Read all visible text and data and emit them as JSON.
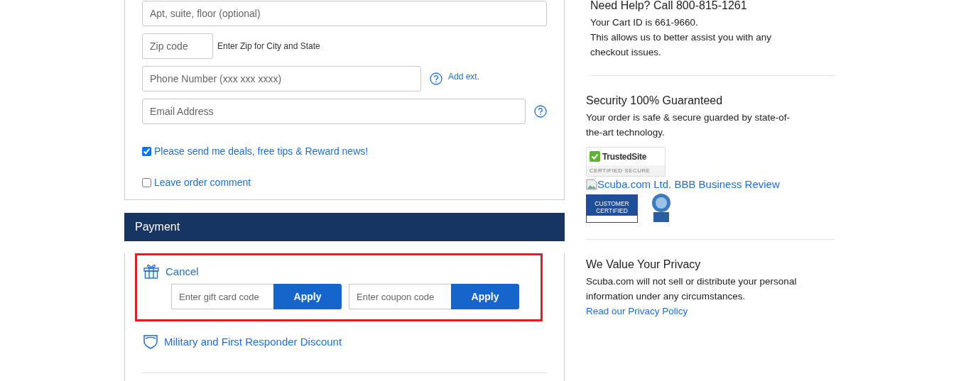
{
  "address_form": {
    "fields": [
      {
        "kind": "wide",
        "placeholder": "Apt, suite, floor (optional)"
      },
      {
        "kind": "zip",
        "placeholder": "Zip code",
        "hint": "Enter Zip for City and State"
      },
      {
        "kind": "phone",
        "placeholder": "Phone Number (xxx xxx xxxx)",
        "help": true,
        "link": "Add ext."
      },
      {
        "kind": "email",
        "placeholder": "Email Address",
        "help": true
      }
    ],
    "options": [
      {
        "label": "Please send me deals, free tips & Reward news!",
        "checked": true
      },
      {
        "label": "Leave order comment",
        "checked": false
      }
    ]
  },
  "payment": {
    "title": "Payment",
    "gift_link": "Cancel",
    "highlighted": true,
    "codes": [
      {
        "placeholder": "Enter gift card code",
        "button": "Apply"
      },
      {
        "placeholder": "Enter coupon code",
        "button": "Apply"
      }
    ],
    "military_link": "Military and First Responder Discount"
  },
  "sidebar": {
    "help": {
      "title": "Need Help? Call 800-815-1261",
      "lines": [
        "Your Cart ID is 661-9660.",
        "This allows us to better assist you with any checkout issues."
      ]
    },
    "security": {
      "title": "Security 100% Guaranteed",
      "text": "Your order is safe & secure guarded by state-of-the-art technology.",
      "trusted_badge": {
        "name": "TrustedSite",
        "sub": "CERTIFIED SECURE"
      },
      "bbb_link": "Scuba.com Ltd. BBB Business Review",
      "bizrate_badge": {
        "lines": [
          "CUSTOMER",
          "CERTIFIED"
        ]
      }
    },
    "privacy": {
      "title": "We Value Your Privacy",
      "text": "Scuba.com will not sell or distribute your personal information under any circumstances.",
      "link": "Read our Privacy Policy"
    }
  }
}
